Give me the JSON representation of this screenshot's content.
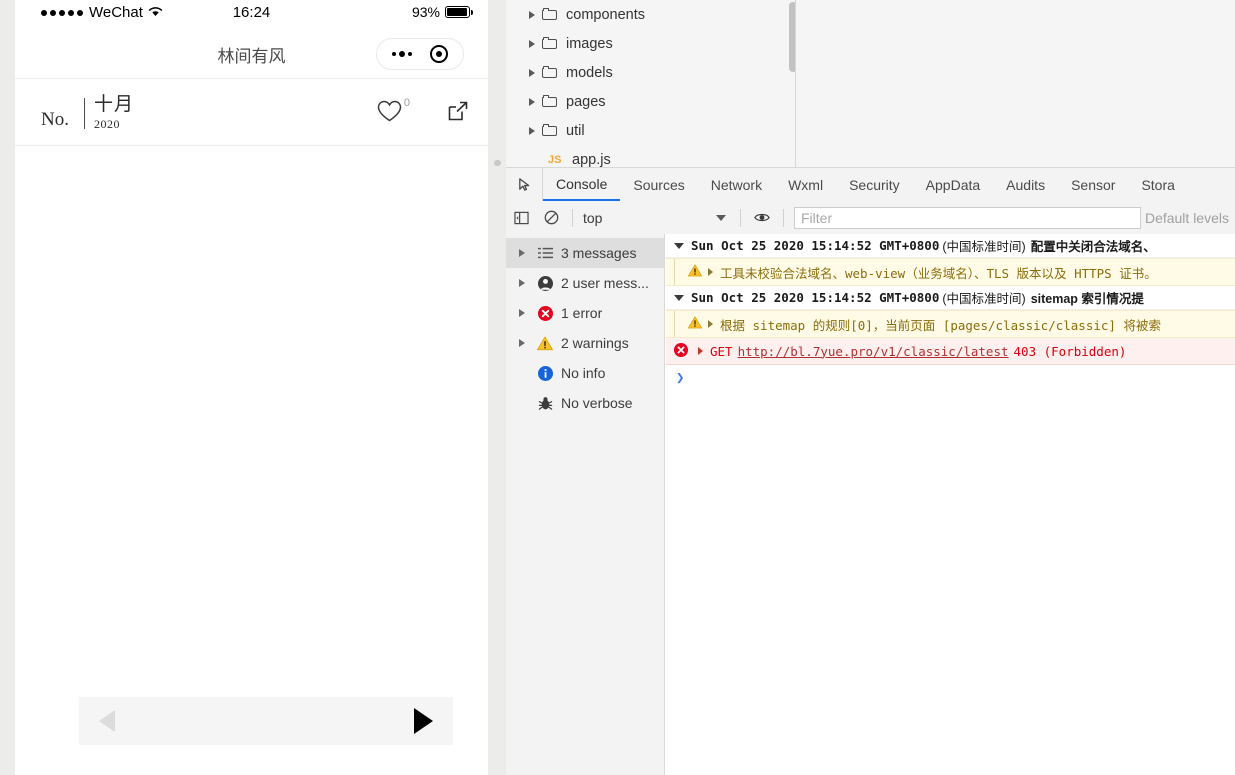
{
  "simulator": {
    "status_bar": {
      "carrier": "WeChat",
      "time": "16:24",
      "battery_percent": "93%"
    },
    "nav": {
      "title": "林间有风"
    },
    "content_header": {
      "no_label": "No.",
      "month": "十月",
      "year": "2020",
      "like_count": "0"
    },
    "bottom_nav": {
      "prev_label": "◀",
      "next_label": "▶"
    }
  },
  "devtools": {
    "file_tree": [
      {
        "label": "components",
        "type": "folder"
      },
      {
        "label": "images",
        "type": "folder"
      },
      {
        "label": "models",
        "type": "folder"
      },
      {
        "label": "pages",
        "type": "folder"
      },
      {
        "label": "util",
        "type": "folder"
      },
      {
        "label": "app.js",
        "type": "file",
        "badge": "JS"
      }
    ],
    "tabs": [
      {
        "label": "Console",
        "active": true
      },
      {
        "label": "Sources",
        "active": false
      },
      {
        "label": "Network",
        "active": false
      },
      {
        "label": "Wxml",
        "active": false
      },
      {
        "label": "Security",
        "active": false
      },
      {
        "label": "AppData",
        "active": false
      },
      {
        "label": "Audits",
        "active": false
      },
      {
        "label": "Sensor",
        "active": false
      },
      {
        "label": "Stora",
        "active": false
      }
    ],
    "filter_bar": {
      "context": "top",
      "filter_placeholder": "Filter",
      "levels": "Default levels"
    },
    "sidebar": [
      {
        "label": "3 messages",
        "icon": "list-icon",
        "selected": true,
        "expandable": true
      },
      {
        "label": "2 user mess...",
        "icon": "user-icon",
        "selected": false,
        "expandable": true
      },
      {
        "label": "1 error",
        "icon": "error-icon",
        "selected": false,
        "expandable": true
      },
      {
        "label": "2 warnings",
        "icon": "warning-icon",
        "selected": false,
        "expandable": true
      },
      {
        "label": "No info",
        "icon": "info-icon",
        "selected": false,
        "expandable": false
      },
      {
        "label": "No verbose",
        "icon": "verbose-icon",
        "selected": false,
        "expandable": false
      }
    ],
    "console": {
      "group1": {
        "date": "Sun Oct 25 2020 15:14:52 GMT+0800",
        "tz": "(中国标准时间)",
        "message": "配置中关闭合法域名、",
        "warning": "工具未校验合法域名、web-view（业务域名）、TLS 版本以及 HTTPS 证书。"
      },
      "group2": {
        "date": "Sun Oct 25 2020 15:14:52 GMT+0800",
        "tz": "(中国标准时间)",
        "message": "sitemap 索引情况提",
        "warning": "根据 sitemap 的规则[0]，当前页面 [pages/classic/classic] 将被索"
      },
      "error": {
        "method": "GET",
        "url": "http://bl.7yue.pro/v1/classic/latest",
        "status": "403 (Forbidden)"
      },
      "prompt": "❯"
    }
  }
}
